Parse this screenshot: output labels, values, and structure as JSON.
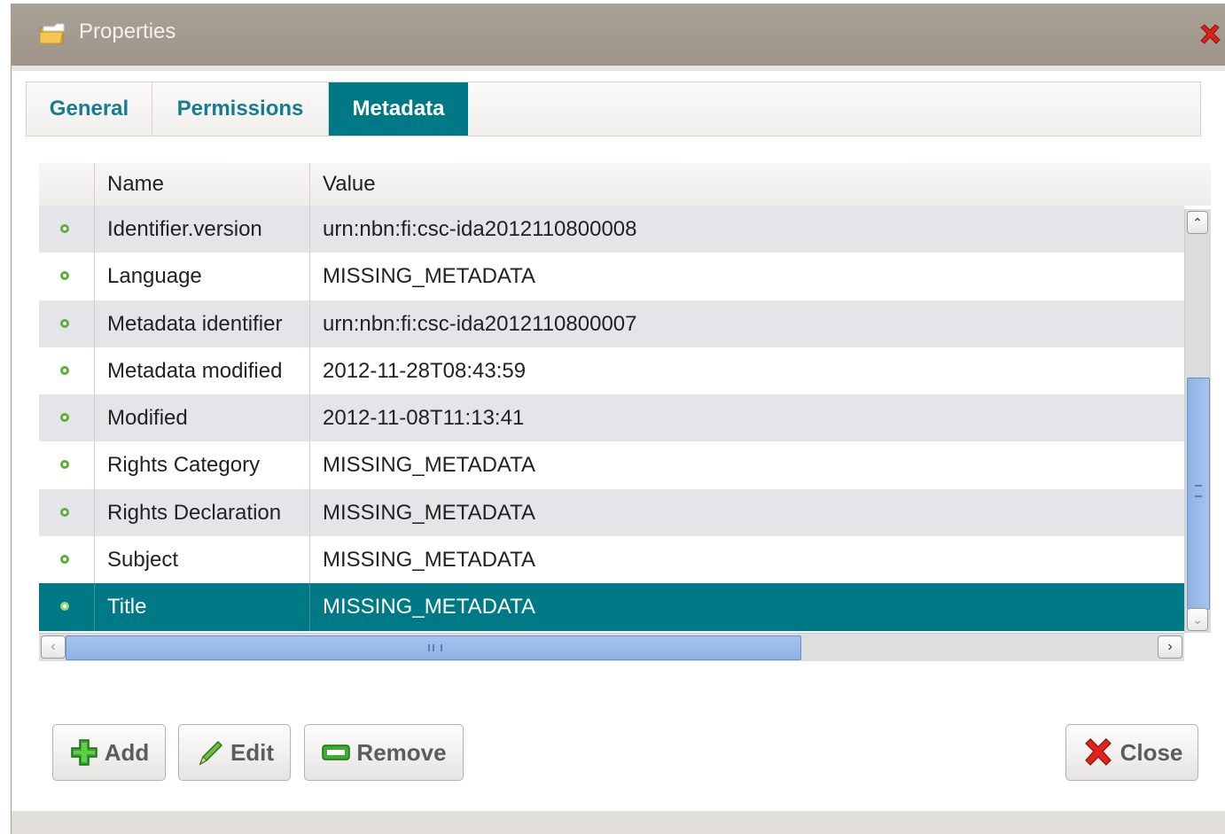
{
  "window": {
    "title": "Properties",
    "icon": "folder-icon",
    "close_icon": "close-icon"
  },
  "tabs": [
    {
      "label": "General",
      "active": false
    },
    {
      "label": "Permissions",
      "active": false
    },
    {
      "label": "Metadata",
      "active": true
    }
  ],
  "grid": {
    "columns": {
      "name": "Name",
      "value": "Value"
    },
    "rows": [
      {
        "name": "Identifier.version",
        "value": "urn:nbn:fi:csc-ida2012110800008"
      },
      {
        "name": "Language",
        "value": "MISSING_METADATA"
      },
      {
        "name": "Metadata identifier",
        "value": "urn:nbn:fi:csc-ida2012110800007"
      },
      {
        "name": "Metadata modified",
        "value": "2012-11-28T08:43:59"
      },
      {
        "name": "Modified",
        "value": "2012-11-08T11:13:41"
      },
      {
        "name": "Rights Category",
        "value": "MISSING_METADATA"
      },
      {
        "name": "Rights Declaration",
        "value": "MISSING_METADATA"
      },
      {
        "name": "Subject",
        "value": "MISSING_METADATA"
      },
      {
        "name": "Title",
        "value": "MISSING_METADATA",
        "selected": true
      }
    ]
  },
  "buttons": {
    "add": "Add",
    "edit": "Edit",
    "remove": "Remove",
    "close": "Close"
  },
  "colors": {
    "accent": "#007987",
    "tab_text": "#157c93",
    "titlebar": "#a39a8f"
  }
}
